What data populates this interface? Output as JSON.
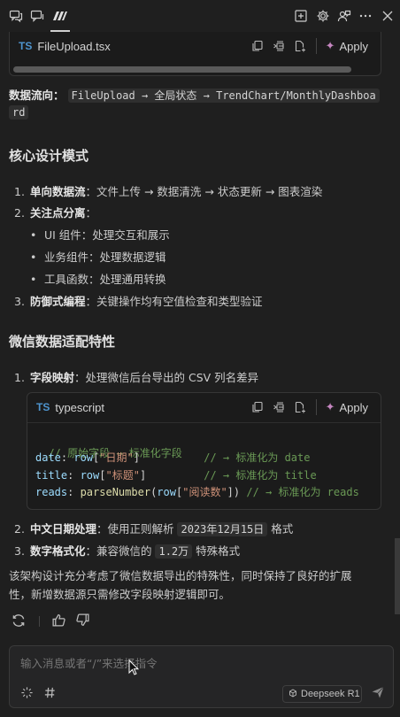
{
  "toolbar": {
    "left_icons": [
      "comment-discussion-icon",
      "chat-icon",
      "m-logo-icon"
    ],
    "right_icons": [
      "plus-square-icon",
      "gear-icon",
      "person-feedback-icon",
      "ellipsis-icon",
      "close-icon"
    ]
  },
  "code_block_1": {
    "badge": "TS",
    "filename": "FileUpload.tsx",
    "apply_label": "Apply"
  },
  "data_flow": {
    "label": "数据流向：",
    "code_line1": "FileUpload → 全局状态 → TrendChart/MonthlyDashboa",
    "code_line2": "rd"
  },
  "section1": {
    "title": "核心设计模式",
    "item1_num": "1.",
    "item1_bold": "单向数据流",
    "item1_text": "：文件上传 → 数据清洗 → 状态更新 → 图表渲染",
    "item2_num": "2.",
    "item2_bold": "关注点分离",
    "item2_text": "：",
    "sub1": "UI 组件：处理交互和展示",
    "sub2": "业务组件：处理数据逻辑",
    "sub3": "工具函数：处理通用转换",
    "item3_num": "3.",
    "item3_bold": "防御式编程",
    "item3_text": "：关键操作均有空值检查和类型验证"
  },
  "section2": {
    "title": "微信数据适配特性",
    "item1_num": "1.",
    "item1_bold": "字段映射",
    "item1_text": "：处理微信后台导出的 CSV 列名差异",
    "item2_num": "2.",
    "item2_bold": "中文日期处理",
    "item2_text": "：使用正则解析 ",
    "item2_code": "2023年12月15日",
    "item2_tail": " 格式",
    "item3_num": "3.",
    "item3_bold": "数字格式化",
    "item3_text": "：兼容微信的 ",
    "item3_code": "1.2万",
    "item3_tail": " 特殊格式"
  },
  "code_block_2": {
    "badge": "TS",
    "language": "typescript",
    "apply_label": "Apply",
    "lines": {
      "l1_comment": "// 原始字段 → 标准化字段",
      "l2_var": "date",
      "l2_mid": ": ",
      "l2_row": "row",
      "l2_open": "[",
      "l2_str": "\"日期\"",
      "l2_close": "]",
      "l2_pad": "          ",
      "l2_comment": "// → 标准化为 date",
      "l3_var": "title",
      "l3_mid": ": ",
      "l3_row": "row",
      "l3_open": "[",
      "l3_str": "\"标题\"",
      "l3_close": "]",
      "l3_pad": "         ",
      "l3_comment": "// → 标准化为 title",
      "l4_var": "reads",
      "l4_mid": ": ",
      "l4_fn": "parseNumber",
      "l4_open": "(",
      "l4_row": "row",
      "l4_br": "[",
      "l4_str": "\"阅读数\"",
      "l4_close": "])",
      "l4_pad": " ",
      "l4_comment": "// → 标准化为 reads"
    }
  },
  "summary": {
    "line1": "该架构设计充分考虑了微信数据导出的特殊性，同时保持了良好的扩展",
    "line2": "性，新增数据源只需修改字段映射逻辑即可。"
  },
  "actions": {
    "icons": [
      "refresh-icon",
      "thumbs-up-icon",
      "thumbs-down-icon"
    ]
  },
  "input": {
    "placeholder": "输入消息或者“/”来选择指令",
    "model_label": "Deepseek R1"
  },
  "colors": {
    "background": "#1f1f1f",
    "accent_ts": "#4e94ce",
    "sparkle": "#c586c0",
    "comment": "#6a9955",
    "string": "#ce9178",
    "variable": "#9cdcfe",
    "function": "#dcdcaa"
  }
}
